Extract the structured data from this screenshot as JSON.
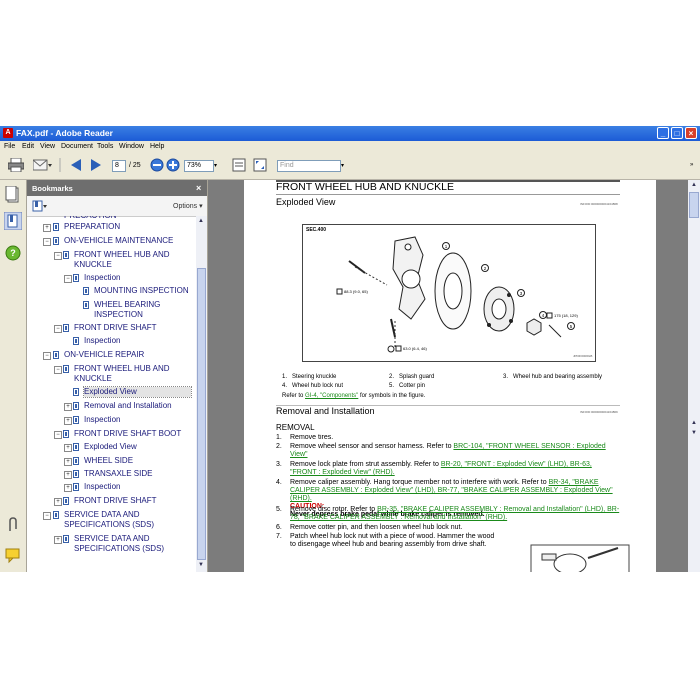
{
  "window": {
    "title": "FAX.pdf - Adobe Reader",
    "buttons": {
      "min": "_",
      "max": "□",
      "close": "×"
    }
  },
  "menu": [
    "File",
    "Edit",
    "View",
    "Document",
    "Tools",
    "Window",
    "Help"
  ],
  "toolbar": {
    "page_current": "8",
    "page_total": "/ 25",
    "zoom": "73%",
    "find_placeholder": "Find"
  },
  "bookmarks": {
    "title": "Bookmarks",
    "options_label": "Options ▾",
    "close": "×",
    "items": [
      {
        "label": "PREPARATION",
        "level": 1,
        "expander": "+"
      },
      {
        "label": "ON-VEHICLE MAINTENANCE",
        "level": 1,
        "expander": "−"
      },
      {
        "label": "FRONT WHEEL HUB AND KNUCKLE",
        "level": 2,
        "expander": "−"
      },
      {
        "label": "Inspection",
        "level": 3,
        "expander": "−"
      },
      {
        "label": "MOUNTING INSPECTION",
        "level": 4,
        "expander": ""
      },
      {
        "label": "WHEEL BEARING INSPECTION",
        "level": 4,
        "expander": ""
      },
      {
        "label": "FRONT DRIVE SHAFT",
        "level": 2,
        "expander": "−"
      },
      {
        "label": "Inspection",
        "level": 3,
        "expander": ""
      },
      {
        "label": "ON-VEHICLE REPAIR",
        "level": 1,
        "expander": "−"
      },
      {
        "label": "FRONT WHEEL HUB AND KNUCKLE",
        "level": 2,
        "expander": "−"
      },
      {
        "label": "Exploded View",
        "level": 3,
        "expander": "",
        "selected": true
      },
      {
        "label": "Removal and Installation",
        "level": 3,
        "expander": "+"
      },
      {
        "label": "Inspection",
        "level": 3,
        "expander": "+"
      },
      {
        "label": "FRONT DRIVE SHAFT BOOT",
        "level": 2,
        "expander": "−"
      },
      {
        "label": "Exploded View",
        "level": 3,
        "expander": "+"
      },
      {
        "label": "WHEEL SIDE",
        "level": 3,
        "expander": "+"
      },
      {
        "label": "TRANSAXLE SIDE",
        "level": 3,
        "expander": "+"
      },
      {
        "label": "Inspection",
        "level": 3,
        "expander": "+"
      },
      {
        "label": "FRONT DRIVE SHAFT",
        "level": 2,
        "expander": "+"
      },
      {
        "label": "SERVICE DATA AND SPECIFICATIONS (SDS)",
        "level": 1,
        "expander": "−"
      },
      {
        "label": "SERVICE DATA AND SPECIFICATIONS (SDS)",
        "level": 2,
        "expander": "+"
      }
    ]
  },
  "document": {
    "title": "FRONT WHEEL HUB AND KNUCKLE",
    "section1": "Exploded View",
    "section1_code": "INFOID:0000000004164868",
    "diagram_sec": "SEC.400",
    "diagram_labels": [
      "1",
      "2",
      "3",
      "4",
      "5"
    ],
    "torques": [
      "88.3 (9.0, 65)",
      "175 (18, 129)",
      "63.0 (6.4, 46)"
    ],
    "diagram_code": "JPDIF0006GB",
    "legend": [
      {
        "num": "1.",
        "text": "Steering knuckle"
      },
      {
        "num": "2.",
        "text": "Splash guard"
      },
      {
        "num": "3.",
        "text": "Wheel hub and bearing assembly"
      },
      {
        "num": "4.",
        "text": "Wheel hub lock nut"
      },
      {
        "num": "5.",
        "text": "Cotter pin"
      }
    ],
    "refer": "Refer to",
    "refer_link": "GI-4, \"Components\"",
    "refer_tail": "for symbols in the figure.",
    "section2": "Removal and Installation",
    "section2_code": "INFOID:0000000004164869",
    "removal_heading": "REMOVAL",
    "steps": [
      {
        "n": "1.",
        "text": "Remove tires."
      },
      {
        "n": "2.",
        "text": "Remove wheel sensor and sensor harness. Refer to",
        "link": "BRC-104, \"FRONT WHEEL SENSOR : Exploded View\""
      },
      {
        "n": "3.",
        "text": "Remove lock plate from strut assembly. Refer to",
        "link": "BR-20, \"FRONT : Exploded View\" (LHD), BR-63, \"FRONT : Exploded View\" (RHD)."
      },
      {
        "n": "4.",
        "text": "Remove caliper assembly. Hang torque member not to interfere with work. Refer to",
        "link": "BR-34, \"BRAKE CALIPER ASSEMBLY : Exploded View\" (LHD), BR-77, \"BRAKE CALIPER ASSEMBLY : Exploded View\" (RHD)."
      },
      {
        "n": "5.",
        "text": "Remove disc rotor. Refer to",
        "link": "BR-35, \"BRAKE CALIPER ASSEMBLY : Removal and Installation\" (LHD), BR-78, \"BRAKE CALIPER ASSEMBLY : Removal and Installation\" (RHD)."
      },
      {
        "n": "6.",
        "text": "Remove cotter pin, and then loosen wheel hub lock nut."
      },
      {
        "n": "7.",
        "text": "Patch wheel hub lock nut with a piece of wood. Hammer the wood to disengage wheel hub and bearing assembly from drive shaft."
      }
    ],
    "caution_label": "CAUTION:",
    "caution_text": "Never depress brake pedal while brake caliper is removed."
  }
}
